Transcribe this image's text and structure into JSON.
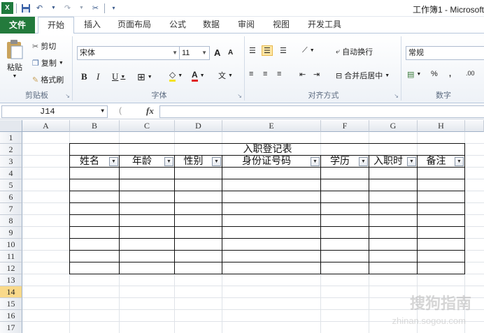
{
  "window": {
    "title": "工作簿1 - Microsoft"
  },
  "qat": {
    "icons": [
      "excel-logo-icon",
      "save-icon",
      "undo-icon",
      "redo-icon",
      "customize-icon"
    ]
  },
  "tabs": {
    "file": "文件",
    "items": [
      "开始",
      "插入",
      "页面布局",
      "公式",
      "数据",
      "审阅",
      "视图",
      "开发工具"
    ]
  },
  "ribbon": {
    "clipboard": {
      "paste": "粘贴",
      "cut": "剪切",
      "copy": "复制",
      "format_painter": "格式刷",
      "label": "剪贴板"
    },
    "font": {
      "font_name": "宋体",
      "font_size": "11",
      "grow": "A",
      "shrink": "A",
      "bold": "B",
      "italic": "I",
      "underline": "U",
      "label": "字体"
    },
    "alignment": {
      "wrap": "自动换行",
      "merge": "合并后居中",
      "label": "对齐方式"
    },
    "number": {
      "format": "常规",
      "percent": "%",
      "comma": ",",
      "decimal": ".00",
      "label": "数字"
    }
  },
  "formula_bar": {
    "name_box": "J14",
    "fx": "fx",
    "formula": ""
  },
  "sheet": {
    "columns": [
      "A",
      "B",
      "C",
      "D",
      "E",
      "F",
      "G",
      "H"
    ],
    "rows": [
      "1",
      "2",
      "3",
      "4",
      "5",
      "6",
      "7",
      "8",
      "9",
      "10",
      "11",
      "12",
      "13",
      "14",
      "15",
      "16",
      "17"
    ],
    "active_row": "14",
    "table_title": "入职登记表",
    "headers": [
      "姓名",
      "年龄",
      "性别",
      "身份证号码",
      "学历",
      "入职时",
      "备注"
    ]
  },
  "watermark": {
    "line1": "搜狗指南",
    "line2": "zhinan.sogou.com"
  }
}
